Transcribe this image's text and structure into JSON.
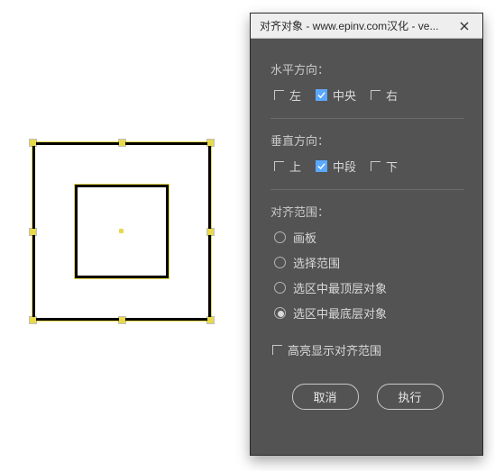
{
  "dialog": {
    "title": "对齐对象 - www.epinv.com汉化 - ve...",
    "horizontal": {
      "label": "水平方向：",
      "left": {
        "label": "左",
        "checked": false
      },
      "center": {
        "label": "中央",
        "checked": true
      },
      "right": {
        "label": "右",
        "checked": false
      }
    },
    "vertical": {
      "label": "垂直方向：",
      "top": {
        "label": "上",
        "checked": false
      },
      "middle": {
        "label": "中段",
        "checked": true
      },
      "bottom": {
        "label": "下",
        "checked": false
      }
    },
    "scope": {
      "label": "对齐范围：",
      "options": [
        {
          "label": "画板",
          "checked": false
        },
        {
          "label": "选择范围",
          "checked": false
        },
        {
          "label": "选区中最顶层对象",
          "checked": false
        },
        {
          "label": "选区中最底层对象",
          "checked": true
        }
      ]
    },
    "highlight": {
      "label": "高亮显示对齐范围",
      "checked": false
    },
    "buttons": {
      "cancel": "取消",
      "apply": "执行"
    }
  }
}
